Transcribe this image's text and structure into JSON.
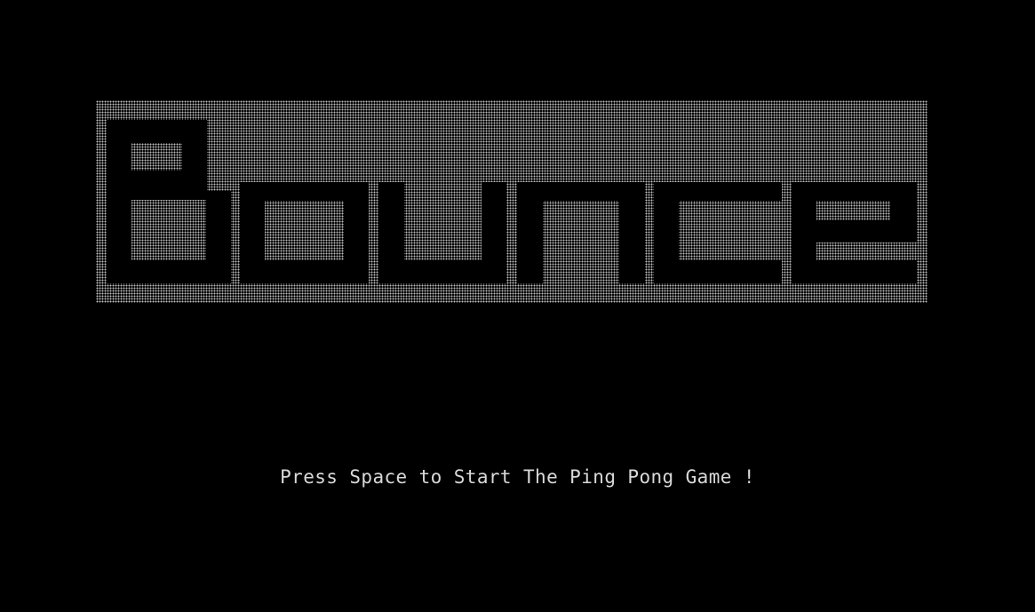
{
  "game": {
    "title": "Bounce",
    "start_prompt": "Press Space to Start The Ping Pong Game !"
  },
  "colors": {
    "background": "#000000",
    "dot_pattern": "#bdbdbd",
    "prompt_text": "#d9d9d9"
  }
}
